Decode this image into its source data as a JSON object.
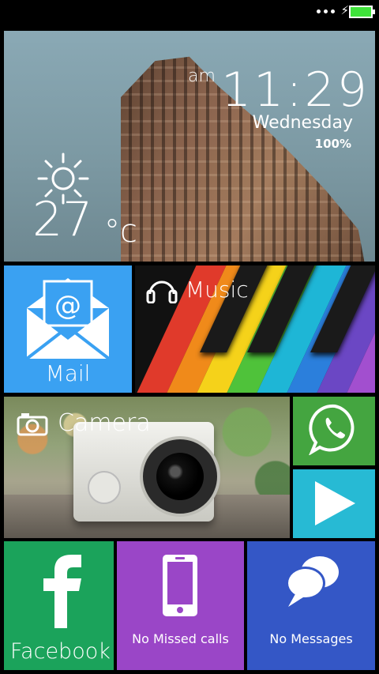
{
  "status_bar": {
    "battery_color": "#3fe23a"
  },
  "clock_tile": {
    "ampm": "am",
    "time": "11:29",
    "day": "Wednesday",
    "battery_percent": "100%",
    "temperature": "27",
    "temperature_unit": "°c",
    "weather_icon": "sun-icon"
  },
  "tiles": {
    "mail": {
      "label": "Mail",
      "color": "#3aa1f2",
      "icon": "mail-icon"
    },
    "music": {
      "label": "Music",
      "icon": "headphones-icon"
    },
    "camera": {
      "label": "Camera",
      "icon": "camera-icon"
    },
    "whatsapp": {
      "color": "#44a540",
      "icon": "whatsapp-icon"
    },
    "play": {
      "color": "#27bad4",
      "icon": "play-icon"
    },
    "facebook": {
      "label": "Facebook",
      "color": "#1ba35b",
      "icon": "facebook-icon"
    },
    "calls": {
      "label": "No Missed calls",
      "color": "#9a46c7",
      "icon": "phone-icon"
    },
    "messages": {
      "label": "No Messages",
      "color": "#3457c6",
      "icon": "chat-bubbles-icon"
    }
  }
}
